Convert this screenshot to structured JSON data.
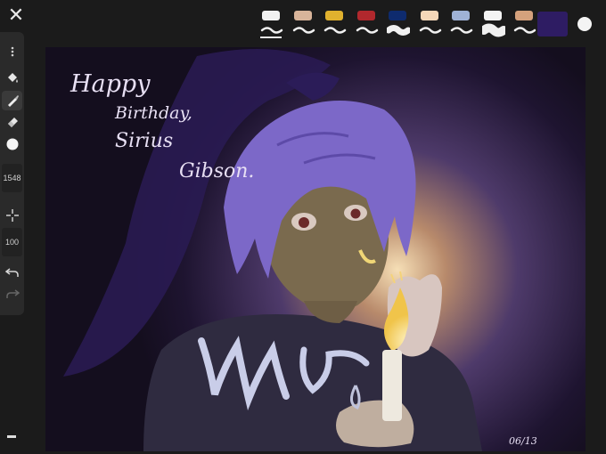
{
  "topbar": {
    "close_icon": "close-icon",
    "brushes": [
      {
        "name": "white-soft",
        "cap": "#f1f1f1",
        "selected": true
      },
      {
        "name": "beige",
        "cap": "#d8b49a"
      },
      {
        "name": "yellow",
        "cap": "#e0b12e"
      },
      {
        "name": "red",
        "cap": "#b1282d"
      },
      {
        "name": "navy",
        "cap": "#0e2b6e"
      },
      {
        "name": "peach",
        "cap": "#f5d7b8"
      },
      {
        "name": "light-blue",
        "cap": "#9fb2d6"
      },
      {
        "name": "white-thick",
        "cap": "#f4f4f4"
      },
      {
        "name": "tan",
        "cap": "#d5a17c"
      }
    ],
    "current_color": "#2e1c63",
    "secondary_color": "#f4f4f4"
  },
  "toolbar": {
    "menu_icon": "more-dots-icon",
    "fill_icon": "paint-bucket-icon",
    "brush_icon": "brush-icon",
    "eraser_icon": "eraser-icon",
    "color_icon": "color-dot-icon",
    "brush_size": "1548",
    "move_icon": "crosshair-icon",
    "opacity": "100",
    "undo_icon": "undo-icon",
    "redo_icon": "redo-icon"
  },
  "artwork": {
    "greeting": [
      "Happy",
      "Birthday,",
      "Sirius",
      "Gibson."
    ],
    "date": "06/13"
  }
}
